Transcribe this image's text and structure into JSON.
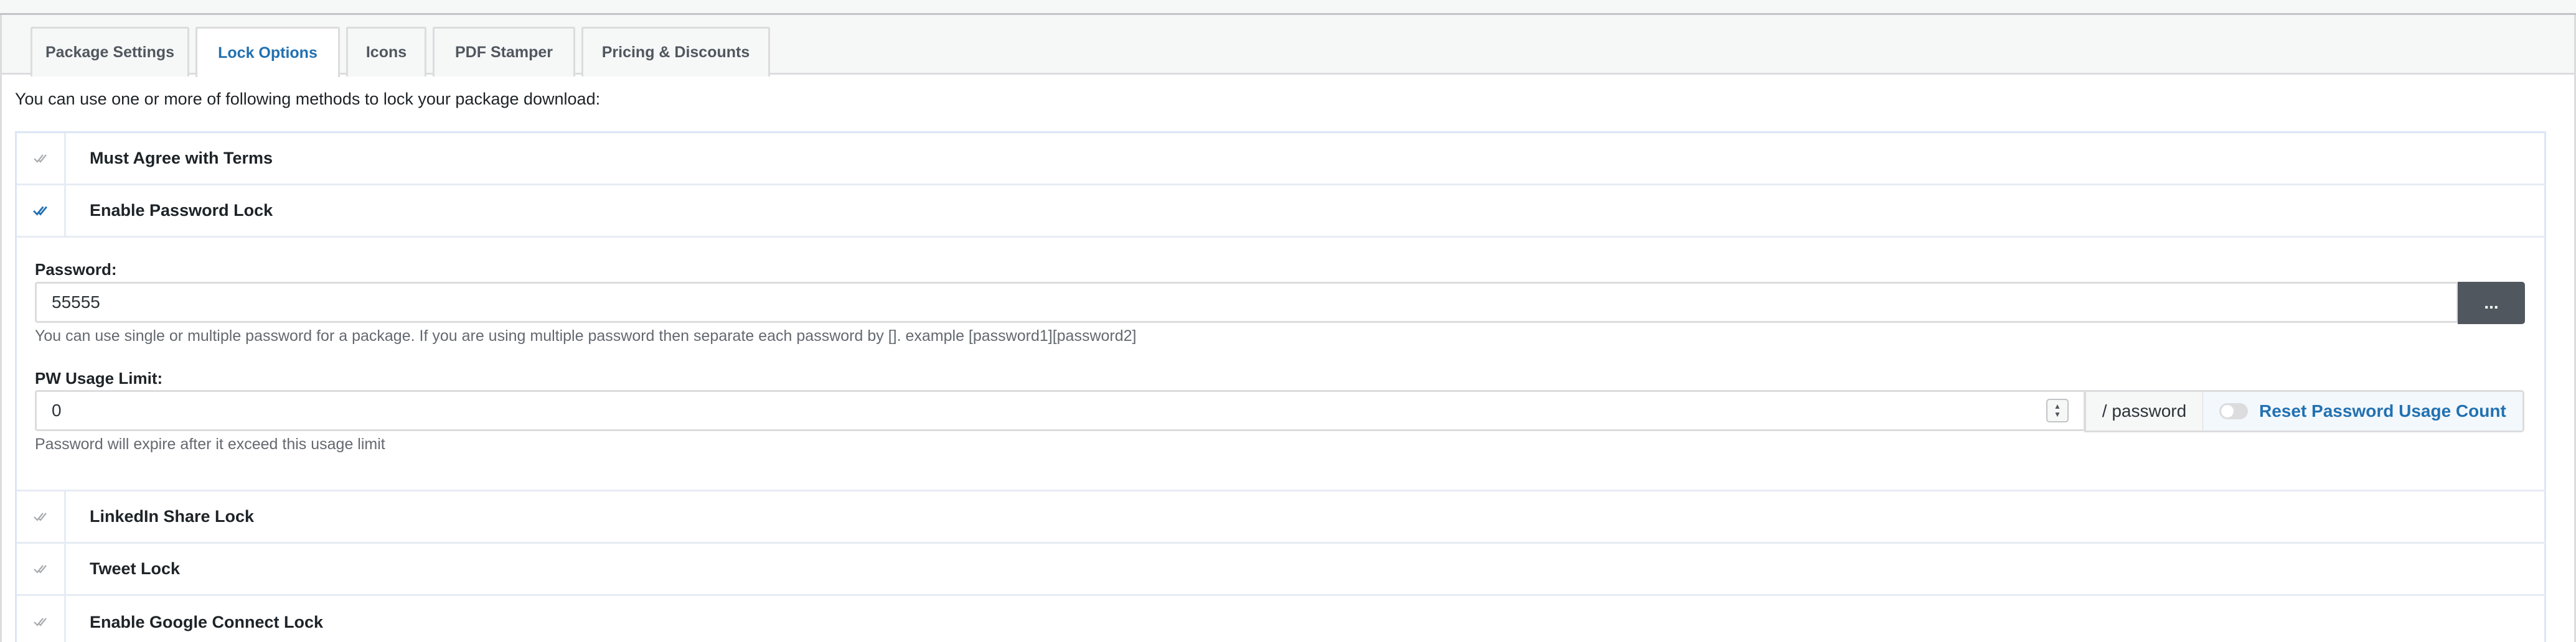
{
  "tabs": [
    {
      "label": "Package Settings",
      "active": false
    },
    {
      "label": "Lock Options",
      "active": true
    },
    {
      "label": "Icons",
      "active": false
    },
    {
      "label": "PDF Stamper",
      "active": false
    },
    {
      "label": "Pricing & Discounts",
      "active": false
    }
  ],
  "intro_text": "You can use one or more of following methods to lock your package download:",
  "locks": {
    "must_agree": {
      "label": "Must Agree with Terms",
      "checked": false
    },
    "password": {
      "label": "Enable Password Lock",
      "checked": true
    },
    "linkedin": {
      "label": "LinkedIn Share Lock",
      "checked": false
    },
    "tweet": {
      "label": "Tweet Lock",
      "checked": false
    },
    "google": {
      "label": "Enable Google Connect Lock",
      "checked": false
    }
  },
  "password_field": {
    "label": "Password:",
    "value": "55555",
    "generate_label": "...",
    "help": "You can use single or multiple password for a package. If you are using multiple password then separate each password by []. example [password1][password2]"
  },
  "usage_limit": {
    "label": "PW Usage Limit:",
    "value": "0",
    "suffix": "/ password",
    "reset_label": "Reset Password Usage Count",
    "help": "Password will expire after it exceed this usage limit"
  },
  "colors": {
    "accent": "#2271b1",
    "check_active": "#2271b1",
    "check_inactive": "#a7aaad"
  }
}
